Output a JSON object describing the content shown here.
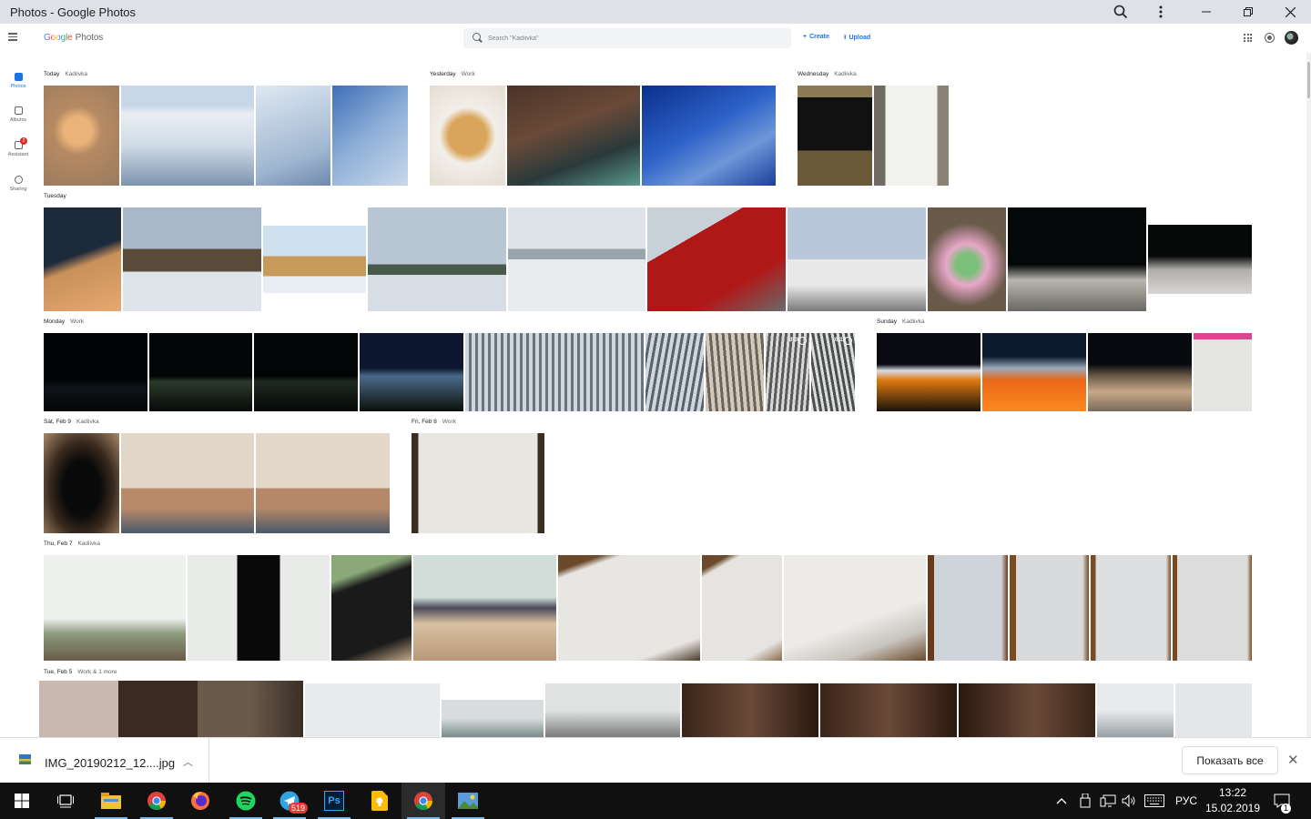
{
  "window": {
    "title": "Photos - Google Photos"
  },
  "app": {
    "logo_google": "Google",
    "logo_photos": "Photos"
  },
  "search": {
    "placeholder": "Search \"Kadiivka\""
  },
  "actions": {
    "create": "Create",
    "upload": "Upload"
  },
  "nav": {
    "items": [
      {
        "label": "Photos",
        "icon": "photos-icon",
        "active": true
      },
      {
        "label": "Albums",
        "icon": "albums-icon"
      },
      {
        "label": "Assistant",
        "icon": "assistant-icon",
        "badge": "2"
      },
      {
        "label": "Sharing",
        "icon": "sharing-icon"
      }
    ]
  },
  "groups": [
    {
      "date": "Today",
      "location": "Kadiivka"
    },
    {
      "date": "Yesterday",
      "location": "Work"
    },
    {
      "date": "Wednesday",
      "location": "Kadiivka"
    },
    {
      "date": "Tuesday",
      "location": ""
    },
    {
      "date": "Monday",
      "location": "Work"
    },
    {
      "date": "Sunday",
      "location": "Kadiivka"
    },
    {
      "date": "Sat, Feb 9",
      "location": "Kadiivka"
    },
    {
      "date": "Fri, Feb 8",
      "location": "Work"
    },
    {
      "date": "Thu, Feb 7",
      "location": "Kadiivka"
    },
    {
      "date": "Tue, Feb 5",
      "location": "Work & 1 more"
    }
  ],
  "videos": [
    {
      "duration": "0:08"
    },
    {
      "duration": "0:12"
    }
  ],
  "download": {
    "filename": "IMG_20190212_12....jpg",
    "show_all": "Показать все"
  },
  "taskbar": {
    "lang": "РУС",
    "time": "13:22",
    "date": "15.02.2019",
    "telegram_badge": "519",
    "notif_count": "1"
  },
  "colors": {
    "accent": "#1a73e8",
    "titlebar": "#dee1e6",
    "taskbar": "#101010"
  }
}
